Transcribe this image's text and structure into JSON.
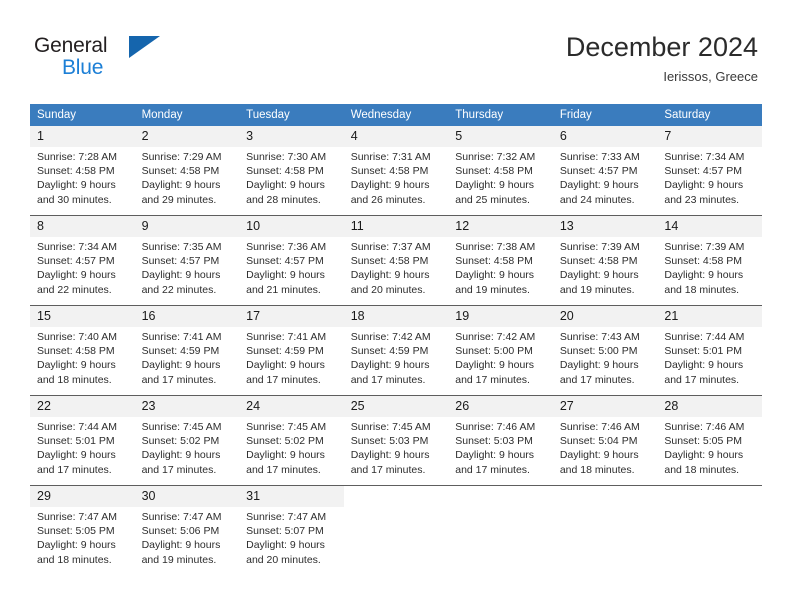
{
  "brand": {
    "name_top": "General",
    "name_bottom": "Blue",
    "color_dark": "#231f20",
    "color_blue": "#1c7fd6",
    "triangle_color": "#1565ad"
  },
  "header": {
    "title": "December 2024",
    "subtitle": "Ierissos, Greece"
  },
  "theme": {
    "header_bg": "#3a7cbe",
    "daynum_bg": "#f2f2f2",
    "row_divider": "#5e5e5e"
  },
  "calendar": {
    "weekday_headers": [
      "Sunday",
      "Monday",
      "Tuesday",
      "Wednesday",
      "Thursday",
      "Friday",
      "Saturday"
    ],
    "weeks": [
      [
        {
          "day": "1",
          "sunrise": "Sunrise: 7:28 AM",
          "sunset": "Sunset: 4:58 PM",
          "daylight1": "Daylight: 9 hours",
          "daylight2": "and 30 minutes."
        },
        {
          "day": "2",
          "sunrise": "Sunrise: 7:29 AM",
          "sunset": "Sunset: 4:58 PM",
          "daylight1": "Daylight: 9 hours",
          "daylight2": "and 29 minutes."
        },
        {
          "day": "3",
          "sunrise": "Sunrise: 7:30 AM",
          "sunset": "Sunset: 4:58 PM",
          "daylight1": "Daylight: 9 hours",
          "daylight2": "and 28 minutes."
        },
        {
          "day": "4",
          "sunrise": "Sunrise: 7:31 AM",
          "sunset": "Sunset: 4:58 PM",
          "daylight1": "Daylight: 9 hours",
          "daylight2": "and 26 minutes."
        },
        {
          "day": "5",
          "sunrise": "Sunrise: 7:32 AM",
          "sunset": "Sunset: 4:58 PM",
          "daylight1": "Daylight: 9 hours",
          "daylight2": "and 25 minutes."
        },
        {
          "day": "6",
          "sunrise": "Sunrise: 7:33 AM",
          "sunset": "Sunset: 4:57 PM",
          "daylight1": "Daylight: 9 hours",
          "daylight2": "and 24 minutes."
        },
        {
          "day": "7",
          "sunrise": "Sunrise: 7:34 AM",
          "sunset": "Sunset: 4:57 PM",
          "daylight1": "Daylight: 9 hours",
          "daylight2": "and 23 minutes."
        }
      ],
      [
        {
          "day": "8",
          "sunrise": "Sunrise: 7:34 AM",
          "sunset": "Sunset: 4:57 PM",
          "daylight1": "Daylight: 9 hours",
          "daylight2": "and 22 minutes."
        },
        {
          "day": "9",
          "sunrise": "Sunrise: 7:35 AM",
          "sunset": "Sunset: 4:57 PM",
          "daylight1": "Daylight: 9 hours",
          "daylight2": "and 22 minutes."
        },
        {
          "day": "10",
          "sunrise": "Sunrise: 7:36 AM",
          "sunset": "Sunset: 4:57 PM",
          "daylight1": "Daylight: 9 hours",
          "daylight2": "and 21 minutes."
        },
        {
          "day": "11",
          "sunrise": "Sunrise: 7:37 AM",
          "sunset": "Sunset: 4:58 PM",
          "daylight1": "Daylight: 9 hours",
          "daylight2": "and 20 minutes."
        },
        {
          "day": "12",
          "sunrise": "Sunrise: 7:38 AM",
          "sunset": "Sunset: 4:58 PM",
          "daylight1": "Daylight: 9 hours",
          "daylight2": "and 19 minutes."
        },
        {
          "day": "13",
          "sunrise": "Sunrise: 7:39 AM",
          "sunset": "Sunset: 4:58 PM",
          "daylight1": "Daylight: 9 hours",
          "daylight2": "and 19 minutes."
        },
        {
          "day": "14",
          "sunrise": "Sunrise: 7:39 AM",
          "sunset": "Sunset: 4:58 PM",
          "daylight1": "Daylight: 9 hours",
          "daylight2": "and 18 minutes."
        }
      ],
      [
        {
          "day": "15",
          "sunrise": "Sunrise: 7:40 AM",
          "sunset": "Sunset: 4:58 PM",
          "daylight1": "Daylight: 9 hours",
          "daylight2": "and 18 minutes."
        },
        {
          "day": "16",
          "sunrise": "Sunrise: 7:41 AM",
          "sunset": "Sunset: 4:59 PM",
          "daylight1": "Daylight: 9 hours",
          "daylight2": "and 17 minutes."
        },
        {
          "day": "17",
          "sunrise": "Sunrise: 7:41 AM",
          "sunset": "Sunset: 4:59 PM",
          "daylight1": "Daylight: 9 hours",
          "daylight2": "and 17 minutes."
        },
        {
          "day": "18",
          "sunrise": "Sunrise: 7:42 AM",
          "sunset": "Sunset: 4:59 PM",
          "daylight1": "Daylight: 9 hours",
          "daylight2": "and 17 minutes."
        },
        {
          "day": "19",
          "sunrise": "Sunrise: 7:42 AM",
          "sunset": "Sunset: 5:00 PM",
          "daylight1": "Daylight: 9 hours",
          "daylight2": "and 17 minutes."
        },
        {
          "day": "20",
          "sunrise": "Sunrise: 7:43 AM",
          "sunset": "Sunset: 5:00 PM",
          "daylight1": "Daylight: 9 hours",
          "daylight2": "and 17 minutes."
        },
        {
          "day": "21",
          "sunrise": "Sunrise: 7:44 AM",
          "sunset": "Sunset: 5:01 PM",
          "daylight1": "Daylight: 9 hours",
          "daylight2": "and 17 minutes."
        }
      ],
      [
        {
          "day": "22",
          "sunrise": "Sunrise: 7:44 AM",
          "sunset": "Sunset: 5:01 PM",
          "daylight1": "Daylight: 9 hours",
          "daylight2": "and 17 minutes."
        },
        {
          "day": "23",
          "sunrise": "Sunrise: 7:45 AM",
          "sunset": "Sunset: 5:02 PM",
          "daylight1": "Daylight: 9 hours",
          "daylight2": "and 17 minutes."
        },
        {
          "day": "24",
          "sunrise": "Sunrise: 7:45 AM",
          "sunset": "Sunset: 5:02 PM",
          "daylight1": "Daylight: 9 hours",
          "daylight2": "and 17 minutes."
        },
        {
          "day": "25",
          "sunrise": "Sunrise: 7:45 AM",
          "sunset": "Sunset: 5:03 PM",
          "daylight1": "Daylight: 9 hours",
          "daylight2": "and 17 minutes."
        },
        {
          "day": "26",
          "sunrise": "Sunrise: 7:46 AM",
          "sunset": "Sunset: 5:03 PM",
          "daylight1": "Daylight: 9 hours",
          "daylight2": "and 17 minutes."
        },
        {
          "day": "27",
          "sunrise": "Sunrise: 7:46 AM",
          "sunset": "Sunset: 5:04 PM",
          "daylight1": "Daylight: 9 hours",
          "daylight2": "and 18 minutes."
        },
        {
          "day": "28",
          "sunrise": "Sunrise: 7:46 AM",
          "sunset": "Sunset: 5:05 PM",
          "daylight1": "Daylight: 9 hours",
          "daylight2": "and 18 minutes."
        }
      ],
      [
        {
          "day": "29",
          "sunrise": "Sunrise: 7:47 AM",
          "sunset": "Sunset: 5:05 PM",
          "daylight1": "Daylight: 9 hours",
          "daylight2": "and 18 minutes."
        },
        {
          "day": "30",
          "sunrise": "Sunrise: 7:47 AM",
          "sunset": "Sunset: 5:06 PM",
          "daylight1": "Daylight: 9 hours",
          "daylight2": "and 19 minutes."
        },
        {
          "day": "31",
          "sunrise": "Sunrise: 7:47 AM",
          "sunset": "Sunset: 5:07 PM",
          "daylight1": "Daylight: 9 hours",
          "daylight2": "and 20 minutes."
        },
        {
          "day": "",
          "sunrise": "",
          "sunset": "",
          "daylight1": "",
          "daylight2": ""
        },
        {
          "day": "",
          "sunrise": "",
          "sunset": "",
          "daylight1": "",
          "daylight2": ""
        },
        {
          "day": "",
          "sunrise": "",
          "sunset": "",
          "daylight1": "",
          "daylight2": ""
        },
        {
          "day": "",
          "sunrise": "",
          "sunset": "",
          "daylight1": "",
          "daylight2": ""
        }
      ]
    ]
  }
}
